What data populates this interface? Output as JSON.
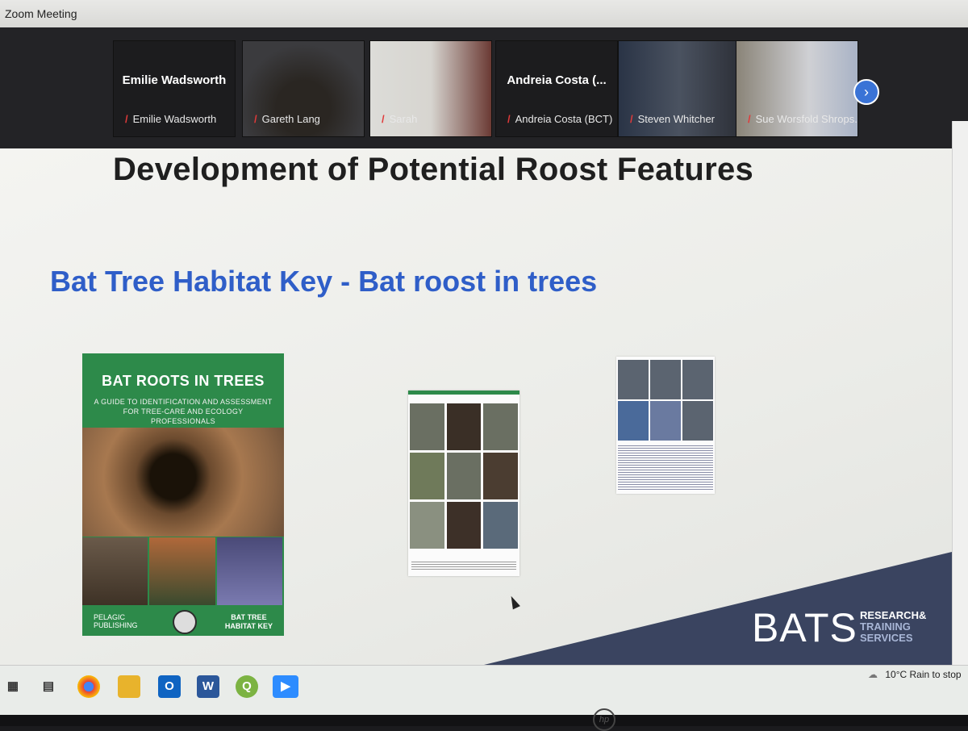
{
  "window": {
    "title": "Zoom Meeting"
  },
  "participants": [
    {
      "display_name": "Emilie Wadsworth",
      "label": "Emilie Wadsworth",
      "muted": true
    },
    {
      "label": "Gareth Lang",
      "muted": true
    },
    {
      "label": "Sarah",
      "muted": true
    },
    {
      "display_name": "Andreia Costa (...",
      "label": "Andreia Costa (BCT)",
      "muted": true
    },
    {
      "label": "Steven Whitcher",
      "muted": true
    },
    {
      "label": "Sue Worsfold Shrops...",
      "muted": true
    }
  ],
  "slide": {
    "title": "Development of Potential Roost Features",
    "subtitle": "Bat Tree Habitat Key - Bat roost in trees",
    "book": {
      "title": "BAT ROOTS IN TREES",
      "subtitle_line1": "A GUIDE TO IDENTIFICATION AND ASSESSMENT",
      "subtitle_line2": "FOR TREE-CARE AND ECOLOGY PROFESSIONALS",
      "publisher_line1": "PELAGIC",
      "publisher_line2": "PUBLISHING",
      "key_line1": "BAT TREE",
      "key_line2": "HABITAT KEY"
    },
    "logo": {
      "main": "BATS",
      "line1": "RESEARCH&",
      "line2": "TRAINING",
      "line3": "SERVICES"
    }
  },
  "taskbar": {
    "weather_temp": "10°C",
    "weather_text": "Rain to stop"
  },
  "colors": {
    "title_blue": "#2f5ec8",
    "book_green": "#2d8a4a",
    "logo_navy": "#3a4460",
    "mute_red": "#e03a3a"
  }
}
